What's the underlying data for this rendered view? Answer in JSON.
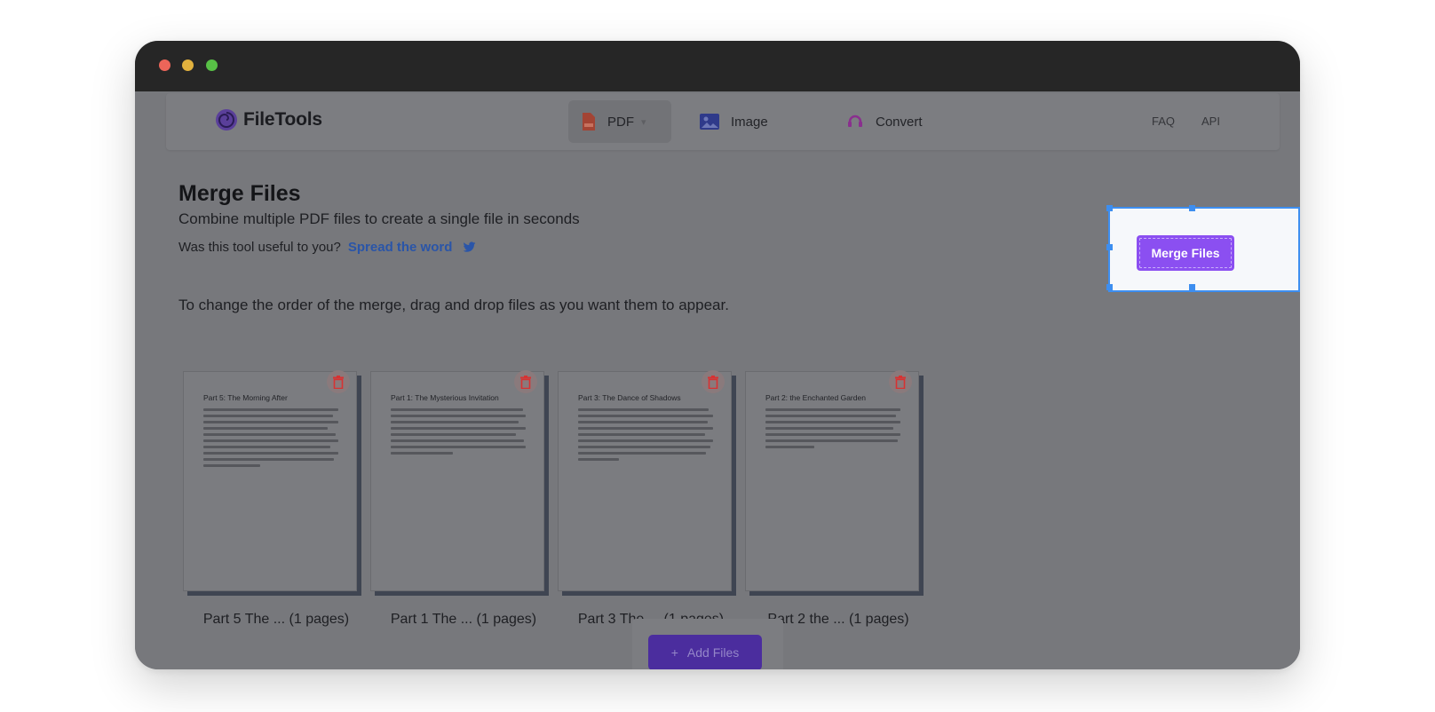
{
  "window": {
    "controls": [
      "close",
      "minimize",
      "maximize"
    ]
  },
  "nav": {
    "brand": "FileTools",
    "items": [
      {
        "label": "PDF",
        "icon": "pdf-file-icon"
      },
      {
        "label": "Image",
        "icon": "image-icon"
      },
      {
        "label": "Convert",
        "icon": "convert-icon"
      }
    ],
    "links": [
      "FAQ",
      "API"
    ]
  },
  "header": {
    "title": "Merge Files",
    "subtitle": "Combine multiple PDF files to create a single file in seconds",
    "useful_text": "Was this tool useful to you?",
    "spread_link": "Spread the word"
  },
  "instruction": "To change the order of the merge, drag and drop files as you want them to appear.",
  "files": [
    {
      "page_title": "Part 5: The Morning After",
      "caption": "Part 5 The ... (1 pages)"
    },
    {
      "page_title": "Part 1: The Mysterious Invitation",
      "caption": "Part 1 The ... (1 pages)"
    },
    {
      "page_title": "Part 3: The Dance of Shadows",
      "caption": "Part 3 The ... (1 pages)"
    },
    {
      "page_title": "Part 2: the Enchanted Garden",
      "caption": "Part 2 the ... (1 pages)"
    }
  ],
  "add_button": "Add Files",
  "merge_button": "Merge Files",
  "colors": {
    "accent": "#8b4ff1",
    "selection": "#3d8ef0",
    "link": "#2a55a8",
    "delete": "#d73232"
  }
}
